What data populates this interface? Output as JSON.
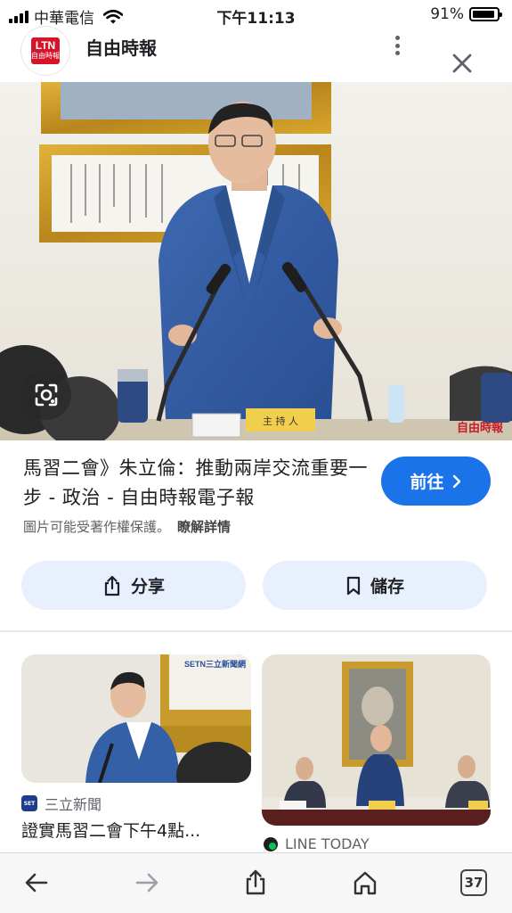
{
  "status_bar": {
    "carrier": "中華電信",
    "time": "下午11:13",
    "battery": "91%",
    "battery_level": 0.91
  },
  "source_header": {
    "logo_line1": "LTN",
    "logo_line2": "自由時報",
    "name": "自由時報"
  },
  "hero": {
    "watermark": "自由時報",
    "nameplate": "主 持 人"
  },
  "result": {
    "title": "馬習二會》朱立倫：推動兩岸交流重要一步 - 政治 - 自由時報電子報",
    "visit_label": "前往",
    "copyright_notice": "圖片可能受著作權保護。",
    "learn_more": "瞭解詳情"
  },
  "actions": {
    "share_label": "分享",
    "save_label": "儲存"
  },
  "related": [
    {
      "source": "三立新聞",
      "badge": "SET",
      "image_watermark": "SETN三立新聞網",
      "title": "證實馬習二會下午4點..."
    },
    {
      "source": "LINE TODAY"
    }
  ],
  "toolbar": {
    "tab_count": "37"
  },
  "colors": {
    "accent": "#1a73e8",
    "chip_bg": "#e8f0fe",
    "brand_red": "#d6152a"
  }
}
